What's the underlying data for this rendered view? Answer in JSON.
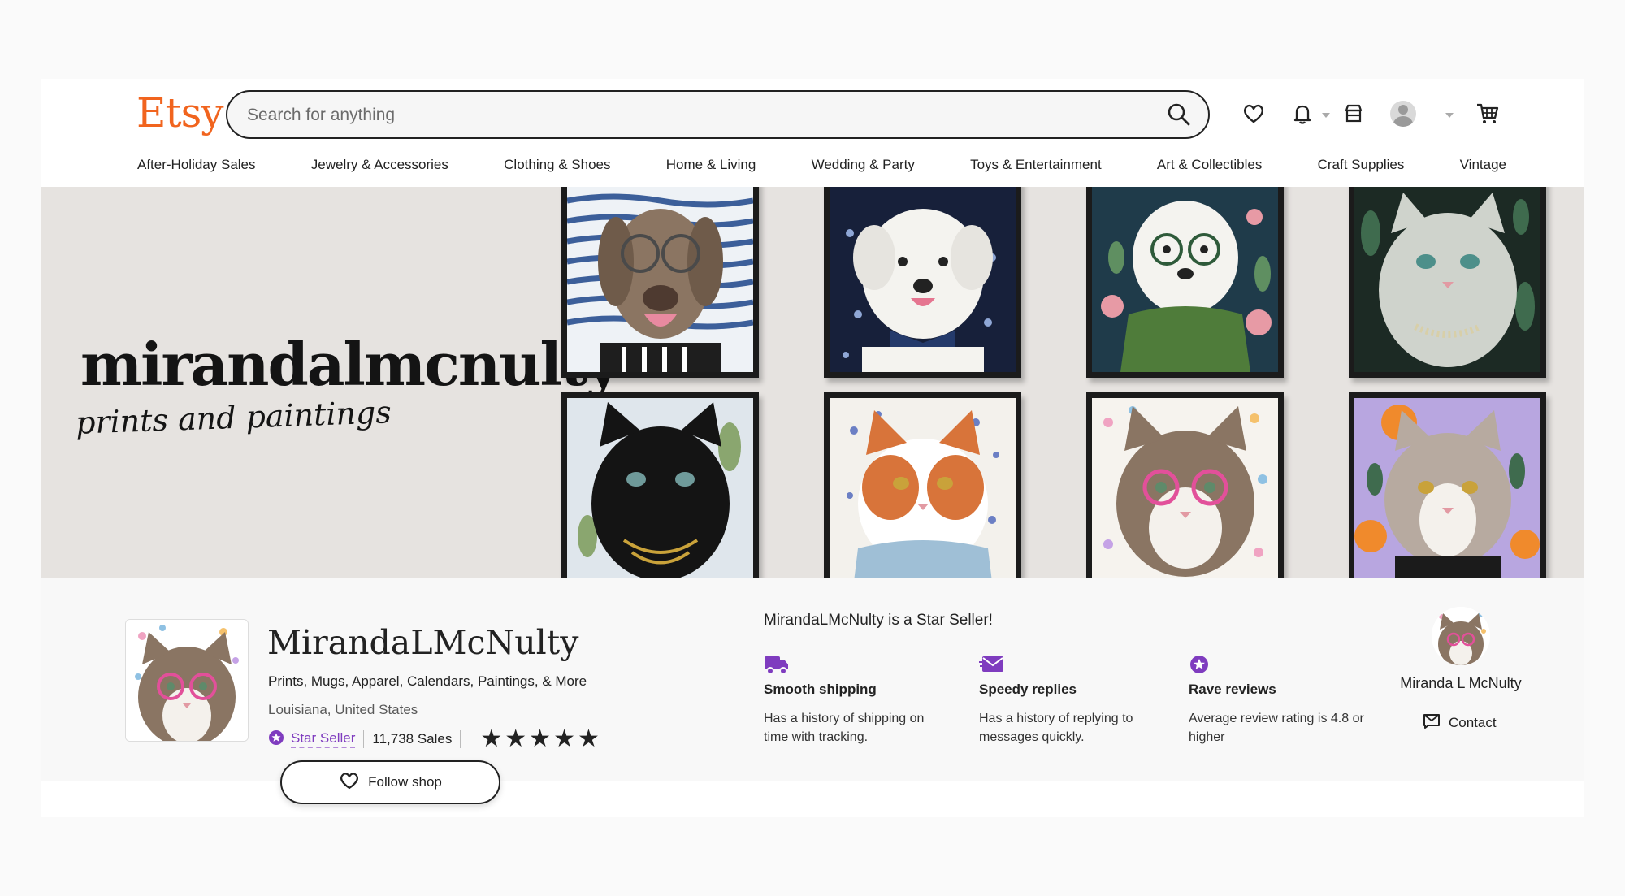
{
  "header": {
    "logo": "Etsy",
    "search_placeholder": "Search for anything"
  },
  "nav": {
    "items": [
      "After-Holiday Sales",
      "Jewelry & Accessories",
      "Clothing & Shoes",
      "Home & Living",
      "Wedding & Party",
      "Toys & Entertainment",
      "Art & Collectibles",
      "Craft Supplies",
      "Vintage"
    ]
  },
  "banner": {
    "title": "mirandalmcnulty",
    "subtitle": "prints and paintings"
  },
  "shop": {
    "name": "MirandaLMcNulty",
    "tagline": "Prints, Mugs, Apparel, Calendars, Paintings, & More",
    "location": "Louisiana, United States",
    "star_seller_label": "Star Seller",
    "sales": "11,738 Sales",
    "rating_stars": 5,
    "follow_label": "Follow shop"
  },
  "star_seller": {
    "title": "MirandaLMcNulty is a Star Seller!",
    "features": [
      {
        "icon": "truck-icon",
        "title": "Smooth shipping",
        "desc": "Has a history of shipping on time with tracking."
      },
      {
        "icon": "envelope-icon",
        "title": "Speedy replies",
        "desc": "Has a history of replying to messages quickly."
      },
      {
        "icon": "star-badge-icon",
        "title": "Rave reviews",
        "desc": "Average review rating is 4.8 or higher"
      }
    ]
  },
  "owner": {
    "name": "Miranda L McNulty",
    "contact_label": "Contact"
  },
  "colors": {
    "brand": "#f1641e",
    "star_seller_purple": "#7f3cbf",
    "banner_bg": "#e6e3e0"
  }
}
